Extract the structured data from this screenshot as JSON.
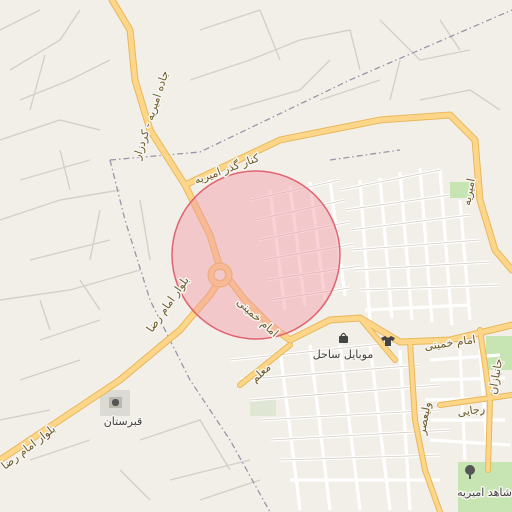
{
  "map": {
    "background_color": "#f2efe9",
    "road_color": "#fdd68a",
    "road_casing_color": "#e8b85a",
    "minor_road_color": "#ffffff",
    "minor_road_casing": "#d6d1c8",
    "boundary_color": "#9a95a8",
    "park_color": "#c7e5b3",
    "highlight_circle": {
      "fill": "#f29aa3",
      "stroke": "#e06470",
      "opacity": 0.45
    }
  },
  "labels": {
    "road_north": "جاده امیریه - کردزار",
    "road_kenar_gozar": "کنار گذر امیریه",
    "road_amiriyeh_east": "امیریه",
    "road_imam_reza_upper": "بلوار امام رضا",
    "road_imam_reza_lower": "بلوار امام رضا",
    "road_imam_khomeini_center": "امام خمینی",
    "road_imam_khomeini_east": "امام خمینی",
    "road_moallem": "معلم",
    "road_jaanbazan": "جانبازان",
    "road_rajaei": "رجایی",
    "road_valiasr": "ولیعصر",
    "poi_mobile": "موبایل ساحل",
    "poi_cemetery": "قبرستان",
    "poi_martyrs": "شاهد امیریه"
  },
  "icons": {
    "mobile_shop": "bag-icon",
    "clothing": "shirt-icon",
    "cemetery": "cemetery-icon",
    "tree": "tree-icon"
  }
}
